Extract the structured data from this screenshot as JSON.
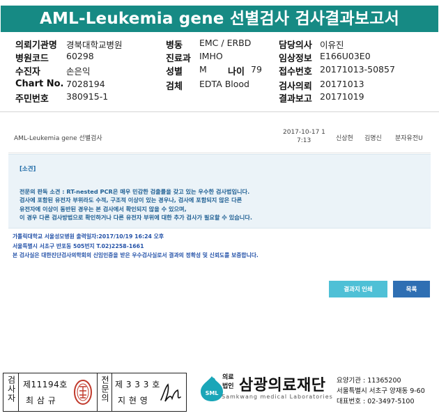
{
  "title": "AML-Leukemia gene 선별검사 검사결과보고서",
  "info": {
    "hospital_label": "의뢰기관명",
    "hospital_value": "경북대학교병원",
    "code_label": "병원코드",
    "code_value": "60298",
    "receiver_label": "수진자",
    "receiver_value": "손은익",
    "chart_label": "Chart No.",
    "chart_value": "7028194",
    "resident_label": "주민번호",
    "resident_value": "380915-1",
    "ward_label": "병동",
    "ward_value": "EMC / ERBD",
    "dept_label": "진료과",
    "dept_value": "IMHO",
    "sex_label": "성별",
    "sex_value": "M",
    "age_label": "나이",
    "age_value": "79",
    "specimen_label": "검체",
    "specimen_value": "EDTA Blood",
    "doctor_label": "담당의사",
    "doctor_value": "이유진",
    "clinical_label": "임상정보",
    "clinical_value": "E166U03E0",
    "receipt_label": "접수번호",
    "receipt_value": "20171013-50857",
    "request_label": "검사의뢰",
    "request_value": "20171013",
    "report_label": "결과보고",
    "report_value": "20171019"
  },
  "result": {
    "test_name": "AML-Leukemia gene 선별검사",
    "datetime_line1": "2017-10-17 1",
    "datetime_line2": "7:13",
    "person1": "신상현",
    "person2": "김명신",
    "dept": "분자유전U"
  },
  "finding": {
    "heading": "[소견]",
    "lines": [
      "전문의 판독 소견 : RT-nested PCR은 매우 민감한 검출률을 갖고 있는 우수한 검사법입니다.",
      "검사에 포함된 유전자 부위라도 수적, 구조적 이상이 있는 경우나, 검사에 포함되지 않은 다른",
      "유전자에 이상이 동반된 경우는 본 검사에서 확인되지 않을 수 있으며,",
      "이 경우 다른 검사방법으로 확인하거나 다른 유전자 부위에 대한 추가 검사가 필요할 수 있습니다."
    ]
  },
  "footer": {
    "line1": "가톨릭대학교 서울성모병원        출력일자:2017/10/19 16:24 오후",
    "line2": "서울특별시 서초구 반포동 505번지 T.02)2258-1661",
    "line3": "본 검사실은 대한진단검사의학회의 신임인증을 받은 우수검사실로서 결과의 정확성 및 신뢰도를 보증합니다."
  },
  "buttons": {
    "view_label": "결과지 인쇄",
    "list_label": "목록"
  },
  "sign": {
    "left_label": "검사자",
    "left_no": "제11194호",
    "left_name": "최 삼 규",
    "right_label": "전문의",
    "right_no": "제 3 3 3 호",
    "right_name": "지 현 영"
  },
  "org": {
    "small_top": "의료",
    "small_bottom": "법인",
    "name": "삼광의료재단",
    "english": "Samkwang medical Laboratories",
    "logo_text": "SML",
    "code_line": "요양기관 : 11365200",
    "address_line": "서울특별시 서초구 양재동 9-60",
    "phone_line": "대표번호 : 02-3497-5100"
  },
  "colors": {
    "title_bg": "#168a84",
    "finding_bg": "#ebf3f8",
    "finding_text": "#1f5f93",
    "footer_text": "#2452a8",
    "button_view": "#4fc0d6",
    "button_list": "#2f6fb3",
    "logo": "#1aa6b8"
  }
}
